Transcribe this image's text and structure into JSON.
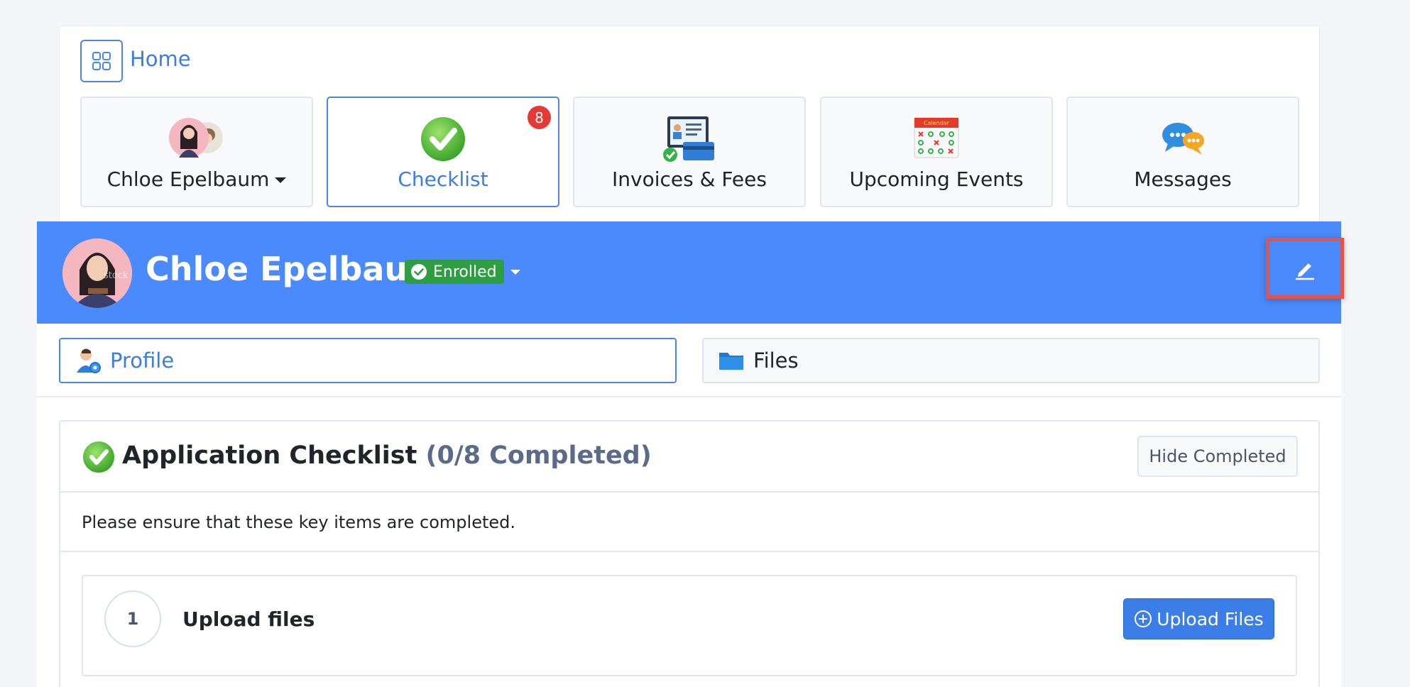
{
  "header": {
    "home_label": "Home"
  },
  "tiles": [
    {
      "label": "Chloe Epelbaum",
      "icon": "student-avatars-icon",
      "has_caret": true
    },
    {
      "label": "Checklist",
      "icon": "check-circle-icon",
      "badge": "8",
      "active": true
    },
    {
      "label": "Invoices & Fees",
      "icon": "invoice-card-icon"
    },
    {
      "label": "Upcoming Events",
      "icon": "calendar-icon",
      "calendar_header": "Calendar"
    },
    {
      "label": "Messages",
      "icon": "chat-bubbles-icon"
    }
  ],
  "student": {
    "name": "Chloe Epelbaum",
    "status": "Enrolled",
    "avatar_watermark": "stock"
  },
  "tabs": [
    {
      "label": "Profile",
      "icon": "profile-gear-icon",
      "active": true
    },
    {
      "label": "Files",
      "icon": "folder-icon",
      "active": false
    }
  ],
  "checklist": {
    "title": "Application Checklist",
    "count": "(0/8 Completed)",
    "hide_button": "Hide Completed",
    "intro": "Please ensure that these key items are completed.",
    "items": [
      {
        "number": "1",
        "label": "Upload files",
        "action": "Upload Files"
      }
    ]
  },
  "colors": {
    "primary": "#4a8afc",
    "accent_blue": "#3b7de0",
    "success": "#2e9e43",
    "badge_red": "#e53935",
    "highlight_red": "#e5534b"
  }
}
